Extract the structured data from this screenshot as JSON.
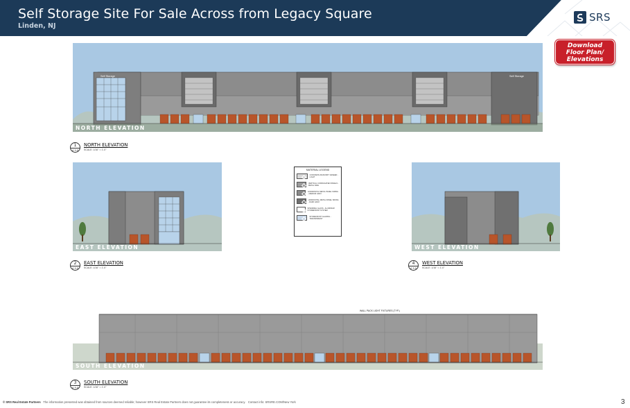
{
  "header": {
    "title": "Self Storage Site For Sale Across from Legacy Square",
    "subtitle": "Linden, NJ",
    "logo_text": "SRS"
  },
  "download_button": {
    "line1": "Download",
    "line2": "Floor Plan/",
    "line3": "Elevations"
  },
  "elevations": {
    "north": {
      "tag": "NORTH ELEVATION",
      "number": "1",
      "sheet": "A 5.0",
      "title": "NORTH ELEVATION",
      "scale": "SCALE: 1/16\" = 1'-0\""
    },
    "east": {
      "tag": "EAST ELEVATION",
      "number": "2",
      "sheet": "A 5.0",
      "title": "EAST ELEVATION",
      "scale": "SCALE: 1/16\" = 1'-0\""
    },
    "west": {
      "tag": "WEST ELEVATION",
      "number": "4",
      "sheet": "A 5.0",
      "title": "WEST ELEVATION",
      "scale": "SCALE: 1/16\" = 1'-0\""
    },
    "south": {
      "tag": "SOUTH ELEVATION",
      "number": "3",
      "sheet": "A 5.0",
      "title": "SOUTH ELEVATION",
      "scale": "SCALE: 1/16\" = 1'-0\""
    }
  },
  "drawing_labels": {
    "self_storage": "Self Storage",
    "wall_pack": "WALL PACK LIGHT FIXTURES (TYP.)"
  },
  "legend": {
    "title": "MATERIAL LEGEND",
    "items": [
      {
        "num": "1",
        "color": "#d9d9d9",
        "text": "CONCRETE MASONRY VENEER - LIGHT"
      },
      {
        "num": "2",
        "color": "#9a9a9a",
        "text": "VERTICAL CORRUGATED PANELS - METAL SIDE"
      },
      {
        "num": "3",
        "color": "#8a8a8a",
        "text": "HORIZONTAL METAL PANEL SIDING - MEDIUM GRAY"
      },
      {
        "num": "4",
        "color": "#6f6f6f",
        "text": "HORIZONTAL METAL PANEL SIDING - DARK GRAY"
      },
      {
        "num": "5",
        "color": "#ffffff",
        "text": "SPANDREL GLASS - ALUMINUM STOREFRONT SYSTEM"
      },
      {
        "num": "6",
        "color": "#c9d9ea",
        "text": "STOREFRONT GLAZING - TRANSPARENT"
      }
    ]
  },
  "footer": {
    "brand": "© SRS Real Estate Partners",
    "disclaimer": "The information presented was obtained from sources deemed reliable; however SRS Real Estate Partners does not guarantee its completeness or accuracy.",
    "contact": "Contact info: SRSRE.COM/New York"
  },
  "page_number": "3",
  "colors": {
    "header_navy": "#1c3a58",
    "accent_red": "#c8202a",
    "sky": "#a9c8e3",
    "door_orange": "#b8552a",
    "wall_gray": "#8c8c8c",
    "wall_dark": "#6a6a6a"
  }
}
